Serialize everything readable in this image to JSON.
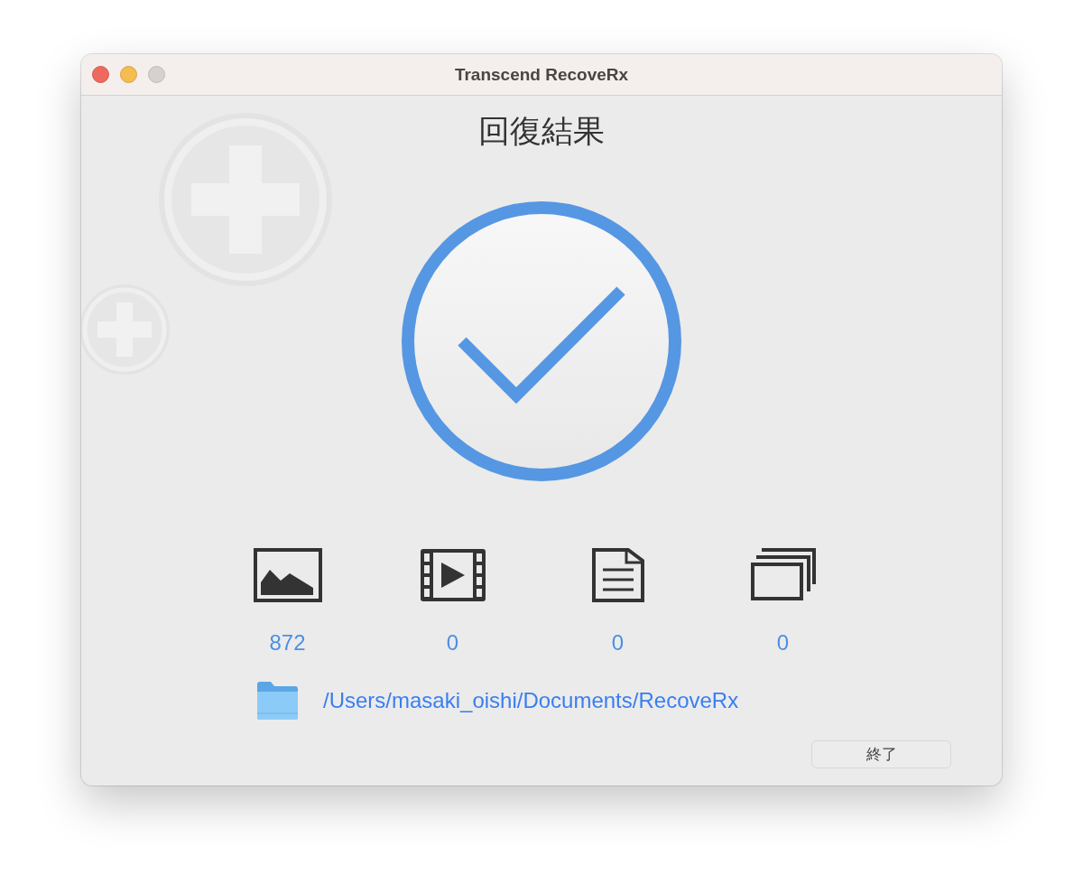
{
  "window": {
    "title": "Transcend RecoveRx"
  },
  "heading": "回復結果",
  "file_types": [
    {
      "kind": "image",
      "count": "872"
    },
    {
      "kind": "video",
      "count": "0"
    },
    {
      "kind": "document",
      "count": "0"
    },
    {
      "kind": "other",
      "count": "0"
    }
  ],
  "output_folder": {
    "path": "/Users/masaki_oishi/Documents/RecoveRx"
  },
  "buttons": [
    {
      "label": "終了"
    }
  ]
}
